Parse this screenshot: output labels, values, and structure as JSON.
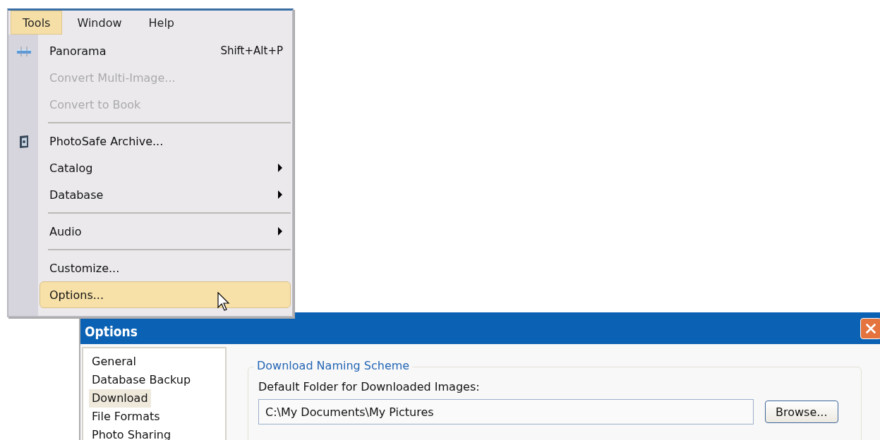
{
  "menu_bar": [
    {
      "label": "Tools",
      "selected": true
    },
    {
      "label": "Window",
      "selected": false
    },
    {
      "label": "Help",
      "selected": false
    }
  ],
  "menu": [
    {
      "kind": "item",
      "label": "Panorama",
      "shortcut": "Shift+Alt+P",
      "disabled": false,
      "submenu": false,
      "selected": false
    },
    {
      "kind": "item",
      "label": "Convert Multi-Image...",
      "disabled": true,
      "submenu": false,
      "selected": false
    },
    {
      "kind": "item",
      "label": "Convert to Book",
      "disabled": true,
      "submenu": false,
      "selected": false
    },
    {
      "kind": "separator"
    },
    {
      "kind": "item",
      "label": "PhotoSafe Archive...",
      "disabled": false,
      "submenu": false,
      "selected": false
    },
    {
      "kind": "item",
      "label": "Catalog",
      "disabled": false,
      "submenu": true,
      "selected": false
    },
    {
      "kind": "item",
      "label": "Database",
      "disabled": false,
      "submenu": true,
      "selected": false
    },
    {
      "kind": "separator"
    },
    {
      "kind": "item",
      "label": "Audio",
      "disabled": false,
      "submenu": true,
      "selected": false
    },
    {
      "kind": "separator"
    },
    {
      "kind": "item",
      "label": "Customize...",
      "disabled": false,
      "submenu": false,
      "selected": false
    },
    {
      "kind": "item",
      "label": "Options...",
      "disabled": false,
      "submenu": false,
      "selected": true
    }
  ],
  "dialog": {
    "title": "Options",
    "categories": [
      {
        "label": "General",
        "selected": false
      },
      {
        "label": "Database Backup",
        "selected": false
      },
      {
        "label": "Download",
        "selected": true
      },
      {
        "label": "File Formats",
        "selected": false
      },
      {
        "label": "Photo Sharing",
        "selected": false
      }
    ],
    "group_title": "Download Naming Scheme",
    "folder_label": "Default Folder for Downloaded Images:",
    "folder_value": "C:\\My Documents\\My Pictures",
    "browse_button": "Browse..."
  }
}
